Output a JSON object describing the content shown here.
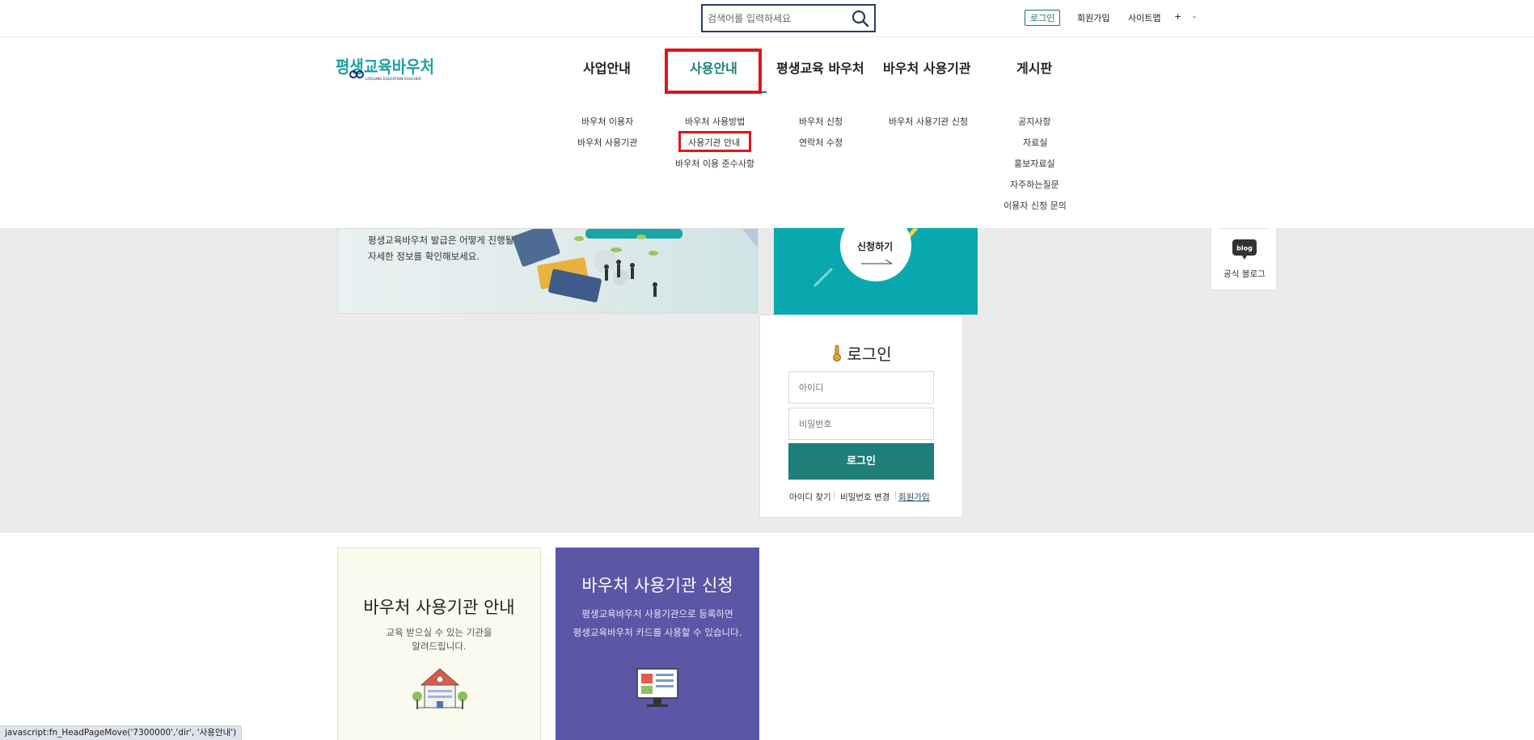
{
  "topbar": {
    "search_placeholder": "검색어를 입력하세요",
    "login": "로그인",
    "signup": "회원가입",
    "sitemap": "사이트맵",
    "zoom_in": "+",
    "zoom_out": "-"
  },
  "header": {
    "logo_text": "평생교육바우처",
    "logo_subtext": "LIFELONG EDUCATION VOUCHER"
  },
  "nav": [
    {
      "label": "사업안내",
      "items": [
        "바우처 이용자",
        "바우처 사용기관"
      ]
    },
    {
      "label": "사용안내",
      "items": [
        "바우처 사용방법",
        "사용기관 안내",
        "바우처 이용 준수사항"
      ]
    },
    {
      "label": "평생교육 바우처",
      "items": [
        "바우처 신청",
        "연락처 수정"
      ]
    },
    {
      "label": "바우처 사용기관",
      "items": [
        "바우처 사용기관 신청"
      ]
    },
    {
      "label": "게시판",
      "items": [
        "공지사항",
        "자료실",
        "홍보자료실",
        "자주하는질문",
        "이용자 신청 문의"
      ]
    }
  ],
  "banner": {
    "line1": "평생교육바우처 발급은 어떻게 진행될까요?",
    "line2": "자세한 정보를 확인해보세요."
  },
  "apply_card": {
    "label": "신청하기"
  },
  "blog": {
    "badge": "blog",
    "label": "공식 블로그"
  },
  "login_box": {
    "title": "로그인",
    "id_placeholder": "아이디",
    "pw_placeholder": "비밀번호",
    "button": "로그인",
    "find_id": "아이디 찾기",
    "change_pw": "비밀번호 변경",
    "signup": "회원가입"
  },
  "cards": {
    "guide": {
      "title": "바우처 사용기관 안내",
      "desc1": "교육 받으실 수 있는 기관을",
      "desc2": "알려드립니다."
    },
    "apply": {
      "title": "바우처 사용기관 신청",
      "desc1": "평생교육바우처 사용기관으로 등록하면",
      "desc2": "평생교육바우처 카드를 사용할 수 있습니다."
    }
  },
  "status_bar": "javascript:fn_HeadPageMove('7300000','dir', '사용안내')",
  "colors": {
    "brand_teal": "#1e7e7a",
    "apply_teal": "#08a8ae",
    "purple": "#5b57a6",
    "highlight_red": "#e0151a",
    "navy": "#2c3a66"
  }
}
